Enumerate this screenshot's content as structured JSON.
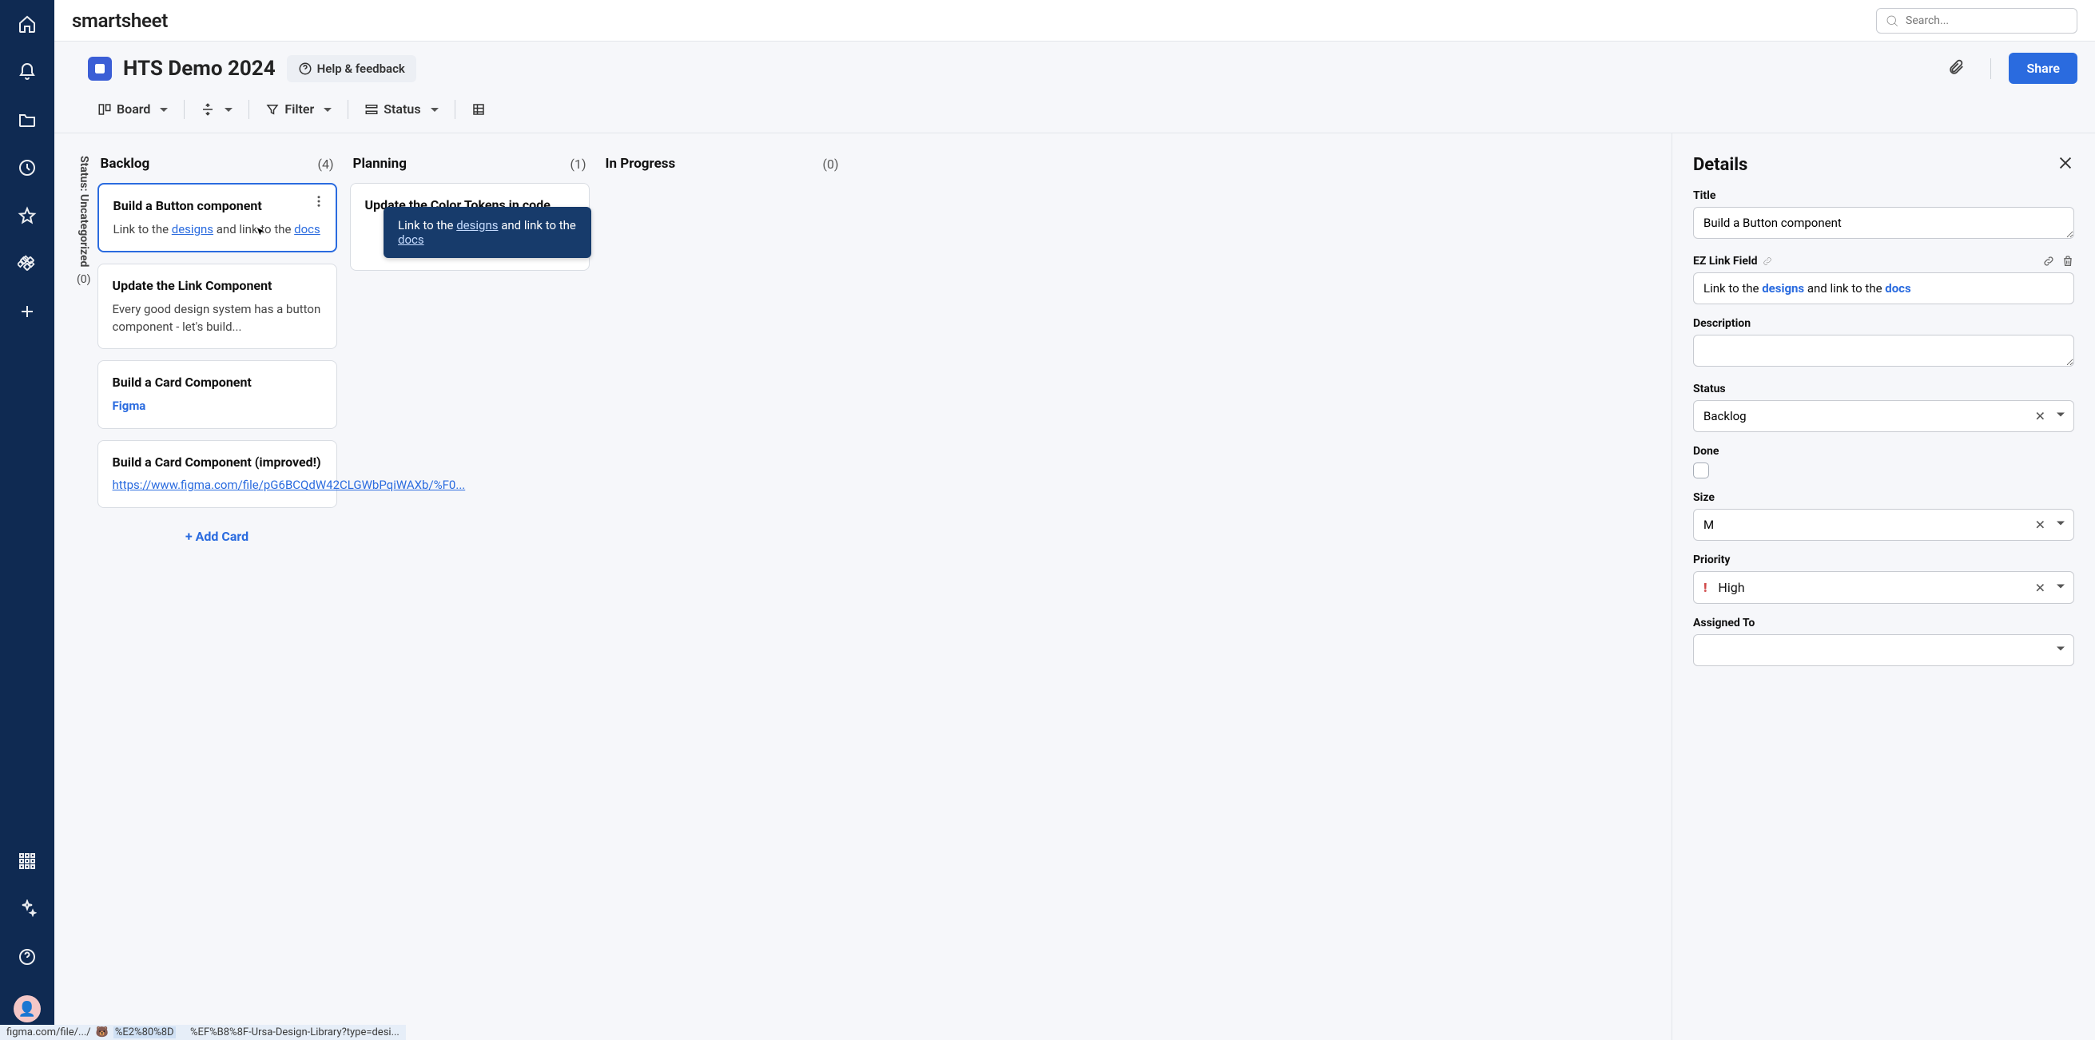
{
  "app": {
    "logo": "smartsheet",
    "search_placeholder": "Search..."
  },
  "workspace": {
    "title": "HTS Demo 2024",
    "help_label": "Help & feedback",
    "share_label": "Share"
  },
  "toolbar": {
    "view_label": "Board",
    "filter_label": "Filter",
    "status_label": "Status"
  },
  "uncategorized": {
    "label": "Status: Uncategorized",
    "count": "(0)"
  },
  "columns": [
    {
      "title": "Backlog",
      "count": "(4)",
      "cards": [
        {
          "title": "Build a Button component",
          "body_prefix": "Link to the ",
          "link1": "designs",
          "body_mid": " and link to the ",
          "link2": "docs",
          "selected": true
        },
        {
          "title": "Update the Link Component",
          "body": "Every good design system has a button component - let's build..."
        },
        {
          "title": "Build a Card Component",
          "link_only": "Figma"
        },
        {
          "title": "Build a Card Component (improved!)",
          "link_url": "https://www.figma.com/file/pG6BCQdW42CLGWbPqiWAXb/%F0..."
        }
      ],
      "add_card_label": "Add Card"
    },
    {
      "title": "Planning",
      "count": "(1)",
      "cards": [
        {
          "title": "Update the Color Tokens in code",
          "has_ellipsis": true
        }
      ]
    },
    {
      "title": "In Progress",
      "count": "(0)",
      "cards": []
    }
  ],
  "tooltip": {
    "prefix": "Link to the ",
    "link1": "designs",
    "mid": " and link to the ",
    "link2": "docs"
  },
  "details": {
    "heading": "Details",
    "title_label": "Title",
    "title_value": "Build a Button component",
    "ezlink_label": "EZ Link Field",
    "ezlink_prefix": "Link to the ",
    "ezlink_link1": "designs",
    "ezlink_mid": " and link to the ",
    "ezlink_link2": "docs",
    "description_label": "Description",
    "description_value": "",
    "status_label": "Status",
    "status_value": "Backlog",
    "done_label": "Done",
    "size_label": "Size",
    "size_value": "M",
    "priority_label": "Priority",
    "priority_value": "High",
    "assigned_label": "Assigned To",
    "assigned_value": ""
  },
  "status_bar": {
    "seg1": "figma.com/file/.../",
    "seg2": "%E2%80%8D",
    "seg3": "%EF%B8%8F-Ursa-Design-Library?type=desi..."
  }
}
